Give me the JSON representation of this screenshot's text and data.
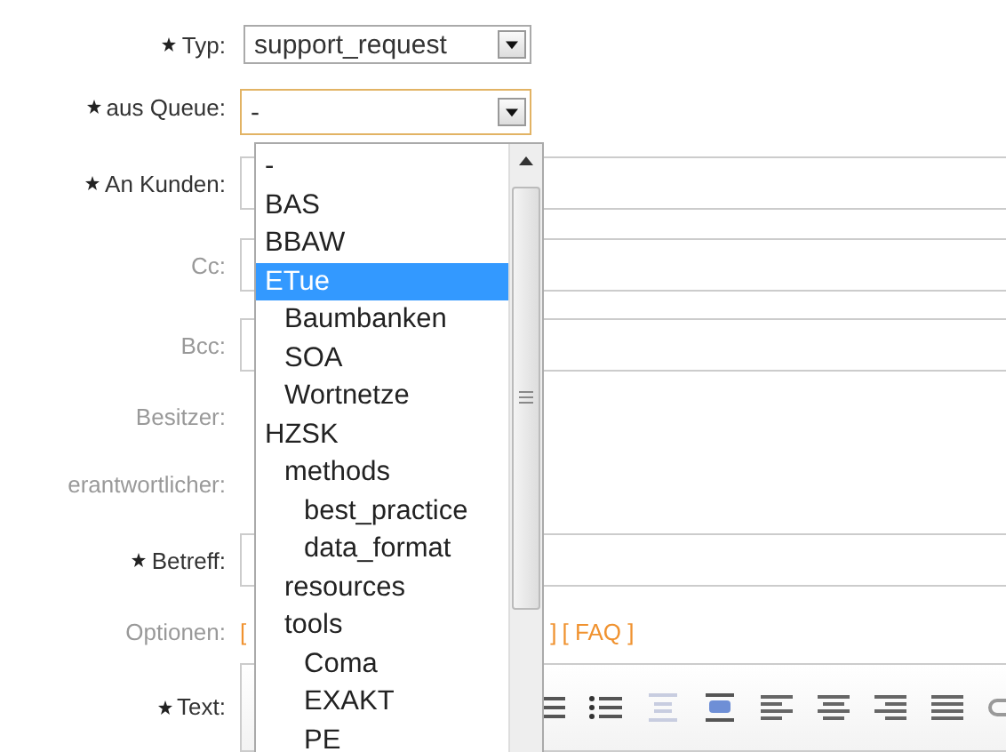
{
  "fields": [
    {
      "kind": "select",
      "label": "Typ:",
      "required": true,
      "value": "support_request"
    },
    {
      "kind": "select_open",
      "label": "aus Queue:",
      "required": true,
      "value": "-"
    },
    {
      "kind": "input",
      "label": "An Kunden:",
      "required": true
    },
    {
      "kind": "input",
      "label": "Cc:",
      "required": false
    },
    {
      "kind": "input",
      "label": "Bcc:",
      "required": false
    },
    {
      "kind": "blank",
      "label": "Besitzer:",
      "required": false
    },
    {
      "kind": "blank",
      "label": "erantwortlicher:",
      "required": false
    },
    {
      "kind": "input",
      "label": "Betreff:",
      "required": true
    },
    {
      "kind": "links",
      "label": "Optionen:",
      "required": false,
      "lead": "[",
      "close": "]",
      "link": "[ FAQ ]"
    },
    {
      "kind": "editor",
      "label": "Text:",
      "required": true
    }
  ],
  "queue_options": [
    {
      "label": "-",
      "selected": false
    },
    {
      "label": "BAS",
      "selected": false
    },
    {
      "label": "BBAW",
      "selected": false
    },
    {
      "label": "ETue",
      "selected": true,
      "children": [
        {
          "label": "Baumbanken",
          "selected": false
        },
        {
          "label": "SOA",
          "selected": false
        },
        {
          "label": "Wortnetze",
          "selected": false
        }
      ]
    },
    {
      "label": "HZSK",
      "selected": false,
      "children": [
        {
          "label": "methods",
          "selected": false,
          "children": [
            {
              "label": "best_practice",
              "selected": false
            },
            {
              "label": "data_format",
              "selected": false
            }
          ]
        },
        {
          "label": "resources",
          "selected": false
        },
        {
          "label": "tools",
          "selected": false,
          "children": [
            {
              "label": "Coma",
              "selected": false
            },
            {
              "label": "EXAKT",
              "selected": false
            },
            {
              "label": "PE",
              "selected": false
            }
          ]
        }
      ]
    }
  ]
}
